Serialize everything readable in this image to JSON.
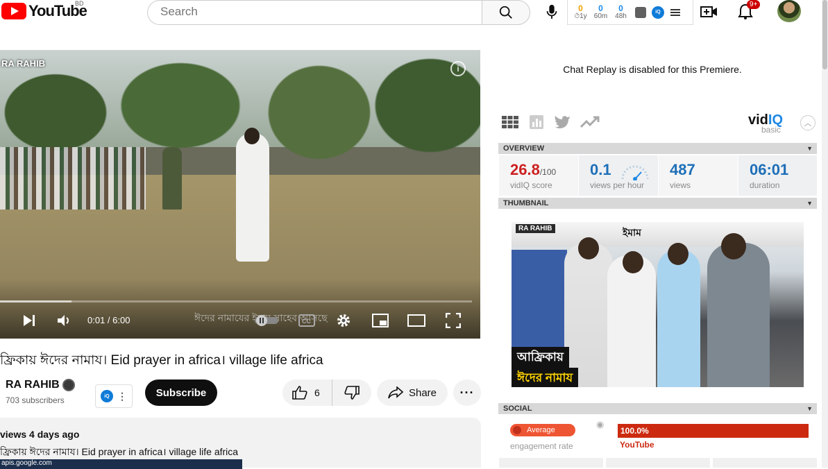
{
  "header": {
    "logo_text": "YouTube",
    "country_code": "BD",
    "search_placeholder": "Search",
    "mini_stats": [
      {
        "value": "0",
        "label": "1y"
      },
      {
        "value": "0",
        "label": "60m"
      },
      {
        "value": "0",
        "label": "48h"
      }
    ],
    "vidiq_badge": "iQ",
    "notification_count": "9+"
  },
  "video": {
    "watermark": "RA RAHIB",
    "overlay_caption": "ঈদের নামাযের ইমাম সাহেব আসছে",
    "time": "0:01 / 6:00",
    "progress": 0.003
  },
  "meta": {
    "title": "ফ্রিকায় ঈদের নামায। Eid prayer in africa। village life africa",
    "channel_name": "RA RAHIB",
    "subscribers": "703 subscribers",
    "subscribe_label": "Subscribe",
    "like_count": "6",
    "share_label": "Share",
    "more_label": "···"
  },
  "description": {
    "meta": "views  4 days ago",
    "line": "ফ্রিকায় ঈদের নামায। Eid prayer in africa। village life africa",
    "link": "apis.google.com"
  },
  "panel": {
    "chat_replay": "Chat Replay is disabled for this Premiere.",
    "vidiq_logo_a": "vid",
    "vidiq_logo_b": "IQ",
    "vidiq_tier": "basic",
    "overview_label": "OVERVIEW",
    "overview": [
      {
        "value": "26.8",
        "suffix": "/100",
        "label": "vidIQ score"
      },
      {
        "value": "0.1",
        "suffix": "",
        "label": "views per hour"
      },
      {
        "value": "487",
        "suffix": "",
        "label": "views"
      },
      {
        "value": "06:01",
        "suffix": "",
        "label": "duration"
      }
    ],
    "thumbnail_label": "THUMBNAIL",
    "thumbnail": {
      "channel_tag": "RA RAHIB",
      "top_text": "ইমাম",
      "caption_1": "আফ্রিকায়",
      "caption_2": "ঈদের নামায"
    },
    "social_label": "SOCIAL",
    "engagement_badge": "Average",
    "engagement_label": "engagement rate",
    "youtube_share": "100.0%",
    "youtube_label": "YouTube"
  },
  "colors": {
    "brand_red": "#ff0000",
    "vidiq_blue": "#1e88e5",
    "score_red": "#cc2020"
  }
}
